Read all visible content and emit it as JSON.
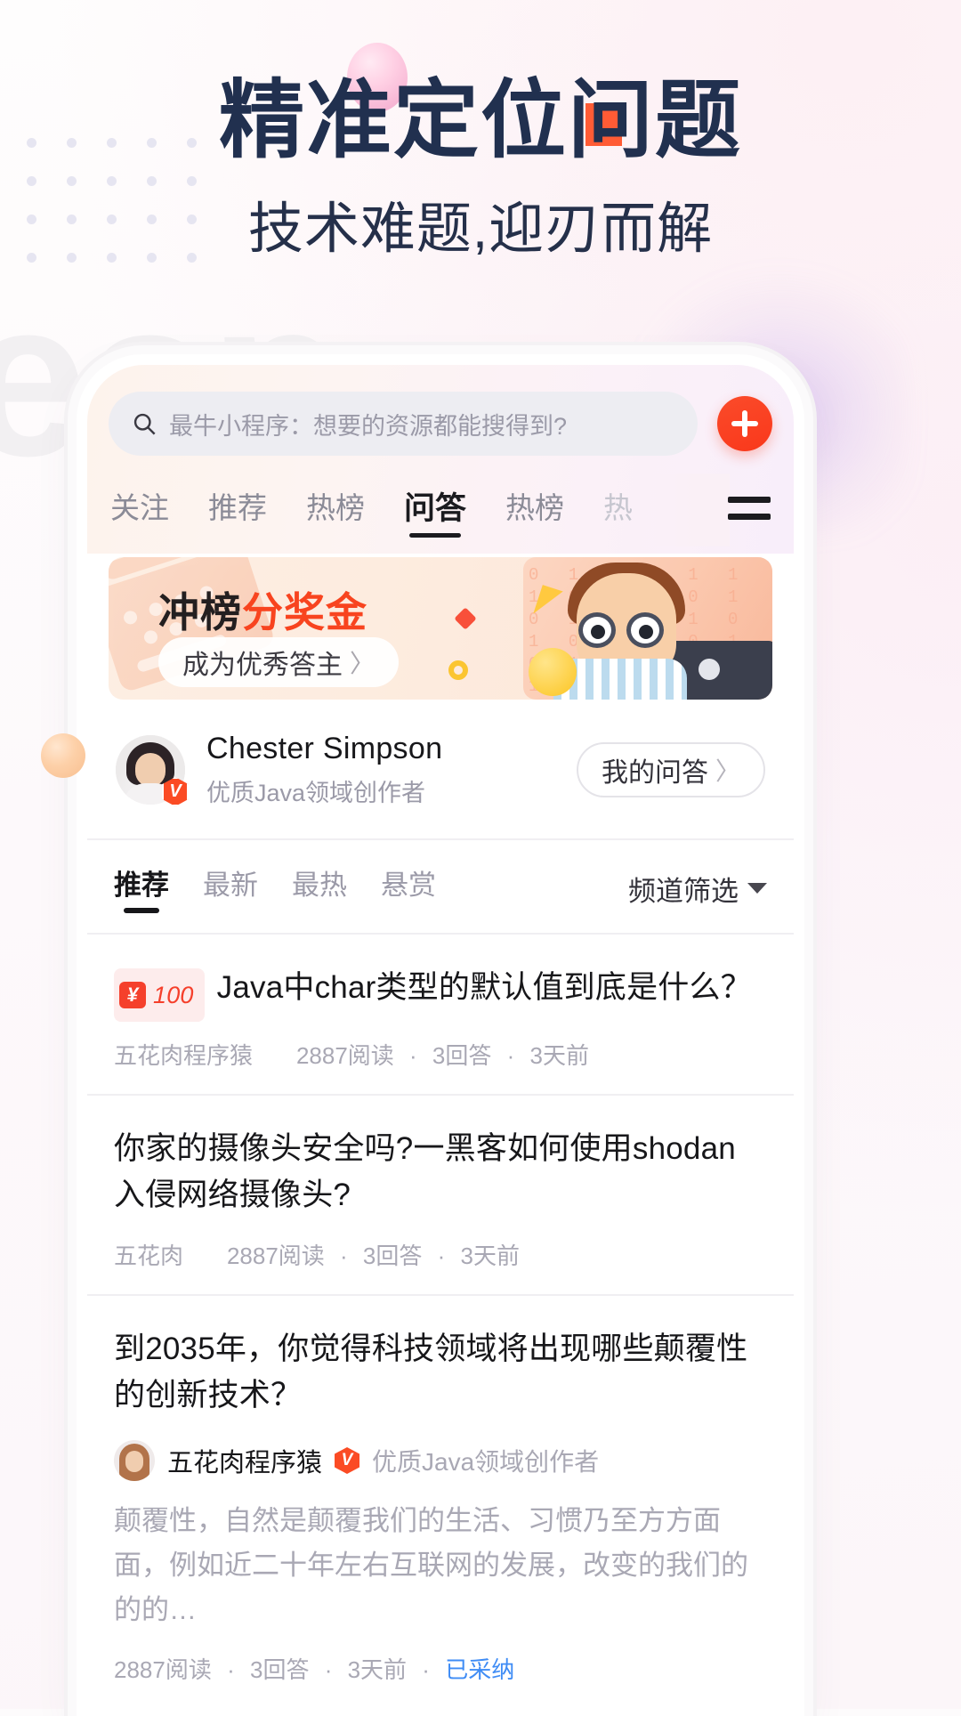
{
  "poster": {
    "title_prefix": "精准定位",
    "title_highlight": "问",
    "title_suffix": "题",
    "subtitle": "技术难题,迎刃而解",
    "accent_navy": "#21304f",
    "accent_orange": "#ff5b35"
  },
  "app": {
    "search": {
      "placeholder": "最牛小程序：想要的资源都能搜得到?",
      "icon": "search-icon"
    },
    "add_button": {
      "icon": "plus-icon",
      "color": "#f9381b"
    },
    "menu_button": {
      "icon": "hamburger-menu-icon"
    },
    "tabs": [
      {
        "label": "关注",
        "active": false
      },
      {
        "label": "推荐",
        "active": false
      },
      {
        "label": "热榜",
        "active": false
      },
      {
        "label": "问答",
        "active": true
      },
      {
        "label": "热榜",
        "active": false
      },
      {
        "label": "热",
        "active": false
      }
    ],
    "banner": {
      "title_dark": "冲榜",
      "title_orange": "分奖金",
      "cta_label": "成为优秀答主",
      "cta_chevron": "〉"
    },
    "profile": {
      "name": "Chester Simpson",
      "role": "优质Java领域创作者",
      "verified_badge": "V",
      "my_qa_label": "我的问答",
      "my_qa_chevron": "〉"
    },
    "subtabs": [
      {
        "label": "推荐",
        "active": true
      },
      {
        "label": "最新",
        "active": false
      },
      {
        "label": "最热",
        "active": false
      },
      {
        "label": "悬赏",
        "active": false
      }
    ],
    "channel_filter": {
      "label": "频道筛选",
      "icon": "caret-down-icon"
    },
    "questions": [
      {
        "bounty": {
          "currency": "¥",
          "amount": "100"
        },
        "title": "Java中char类型的默认值到底是什么？",
        "meta_author": "五花肉程序猿",
        "meta_reads": "2887阅读",
        "meta_answers": "3回答",
        "meta_time": "3天前"
      },
      {
        "title": "你家的摄像头安全吗?一黑客如何使用shodan入侵网络摄像头?",
        "meta_author": "五花肉",
        "meta_reads": "2887阅读",
        "meta_answers": "3回答",
        "meta_time": "3天前"
      },
      {
        "title": "到2035年，你觉得科技领域将出现哪些颠覆性的创新技术？",
        "author_name": "五花肉程序猿",
        "author_badge": "V",
        "author_role": "优质Java领域创作者",
        "excerpt": "颠覆性，自然是颠覆我们的生活、习惯乃至方方面面，例如近二十年左右互联网的发展，改变的我们的的的…",
        "meta_reads": "2887阅读",
        "meta_answers": "3回答",
        "meta_time": "3天前",
        "status": "已采纳",
        "status_color": "#3f8cf5"
      }
    ]
  }
}
